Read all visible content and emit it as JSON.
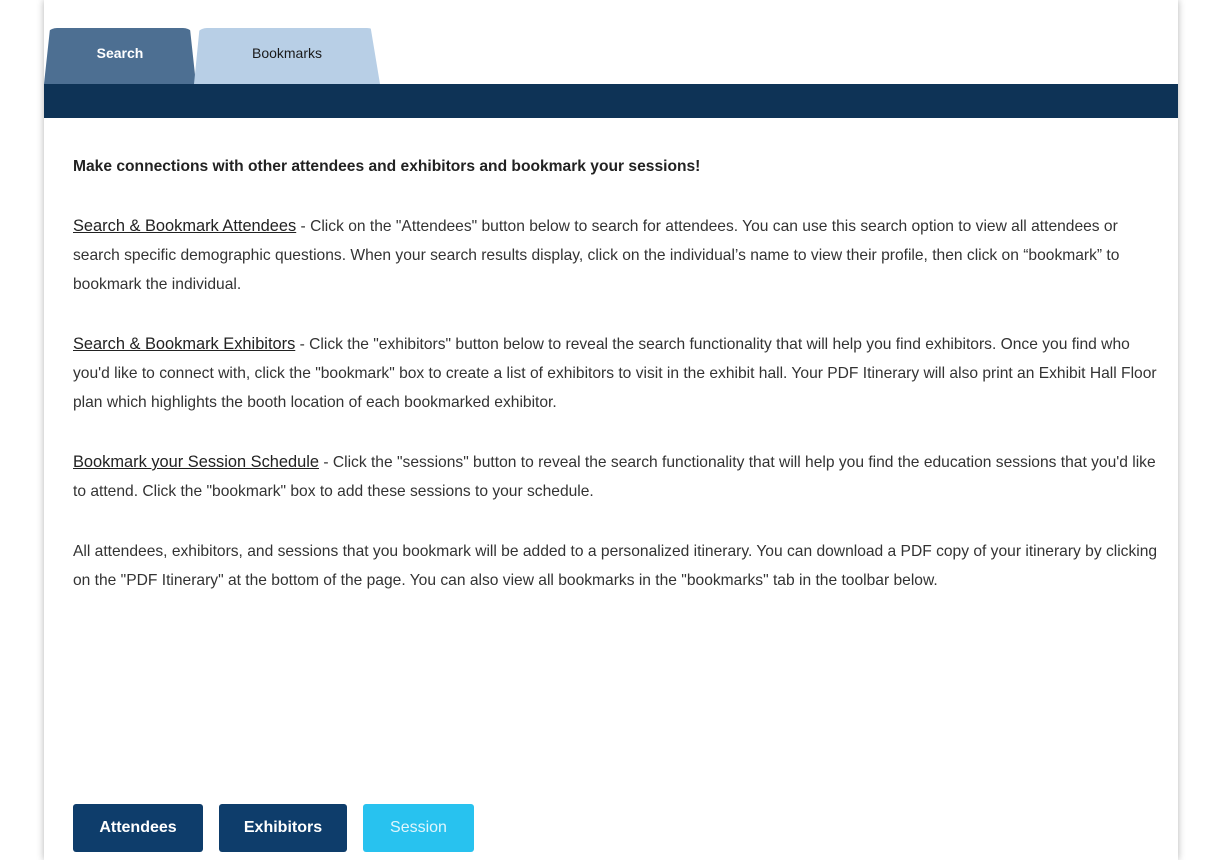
{
  "tabs": {
    "search_label": "Search",
    "bookmarks_label": "Bookmarks"
  },
  "content": {
    "intro": "Make connections with other attendees and exhibitors and bookmark your sessions!",
    "attendees": {
      "heading": "Search & Bookmark Attendees",
      "text": " - Click on the \"Attendees\" button below to search for attendees. You can use this search option to view all attendees or search specific demographic questions.  When your search results display, click on the individual’s name to view their profile, then click on  “bookmark” to bookmark the individual."
    },
    "exhibitors": {
      "heading": "Search & Bookmark Exhibitors",
      "text": " - Click the \"exhibitors\" button below to reveal the search functionality that will help you find exhibitors. Once you find who you'd like to connect with, click the \"bookmark\" box to create a list of exhibitors to visit in the exhibit hall.  Your PDF Itinerary will also print an Exhibit Hall Floor plan which highlights the booth location of each bookmarked exhibitor."
    },
    "sessions": {
      "heading": "Bookmark your Session Schedule",
      "text": " - Click the \"sessions\" button to reveal the search functionality that will help you find the education sessions that you'd like to attend. Click the \"bookmark\" box to add these sessions to your schedule."
    },
    "closing": "All attendees, exhibitors, and sessions that you bookmark will be added to a personalized itinerary. You can download a PDF copy of your itinerary by clicking on the \"PDF Itinerary\" at the bottom of the page. You can also view all bookmarks in the \"bookmarks\" tab in the toolbar below."
  },
  "buttons": {
    "attendees_label": "Attendees",
    "exhibitors_label": "Exhibitors",
    "session_label": "Session"
  },
  "colors": {
    "navbar": "#0e3356",
    "active_tab": "#4d6f92",
    "inactive_tab": "#b8cfe6",
    "primary_button": "#0e3d6b",
    "session_button": "#28c2ef"
  }
}
